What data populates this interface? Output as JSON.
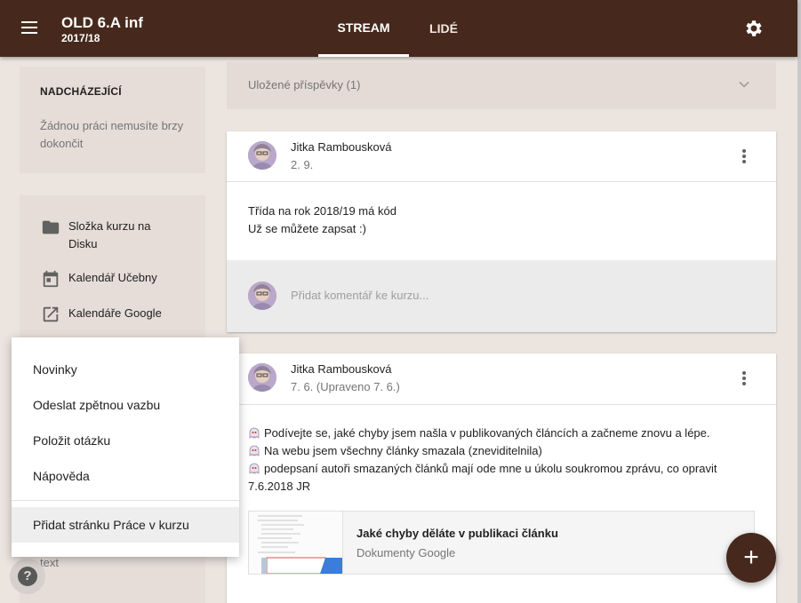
{
  "header": {
    "class_name": "OLD 6.A inf",
    "class_year": "2017/18",
    "tabs": [
      {
        "label": "STREAM",
        "active": true
      },
      {
        "label": "LIDÉ",
        "active": false
      }
    ],
    "bar_color": "#46291c"
  },
  "sidebar": {
    "upcoming_title": "NADCHÁZEJÍCÍ",
    "upcoming_text": "Žádnou práci nemusíte brzy dokončit",
    "links": [
      {
        "icon": "folder-icon",
        "label": "Složka kurzu na Disku"
      },
      {
        "icon": "calendar-icon",
        "label": "Kalendář Učebny"
      },
      {
        "icon": "open-in-new-icon",
        "label": "Kalendáře Google"
      }
    ],
    "text_under_menu": "text"
  },
  "help_menu": {
    "items": [
      "Novinky",
      "Odeslat zpětnou vazbu",
      "Položit otázku",
      "Nápověda"
    ],
    "extra_item": "Přidat stránku Práce v kurzu"
  },
  "stream": {
    "saved_label": "Uložené příspěvky (1)",
    "posts": [
      {
        "author": "Jitka Rambousková",
        "date": "2. 9.",
        "lines": [
          "Třída na rok 2018/19 má kód",
          "Už se můžete zapsat :)"
        ],
        "comment_placeholder": "Přidat komentář ke kurzu..."
      },
      {
        "author": "Jitka Rambousková",
        "date": "7. 6. (Upraveno 7. 6.)",
        "lines": [
          "Podívejte se, jaké chyby jsem našla v publikovaných článcích a začneme znovu a lépe.",
          "Na webu jsem všechny články smazala (zneviditelnila)",
          "podepsaní autoři smazaných článků mají ode mne u úkolu soukromou zprávu, co opravit",
          "7.6.2018 JR"
        ],
        "attachment": {
          "title": "Jaké chyby děláte v publikaci článku",
          "source": "Dokumenty Google"
        }
      }
    ]
  },
  "fab_label": "+",
  "help_fab_label": "?"
}
